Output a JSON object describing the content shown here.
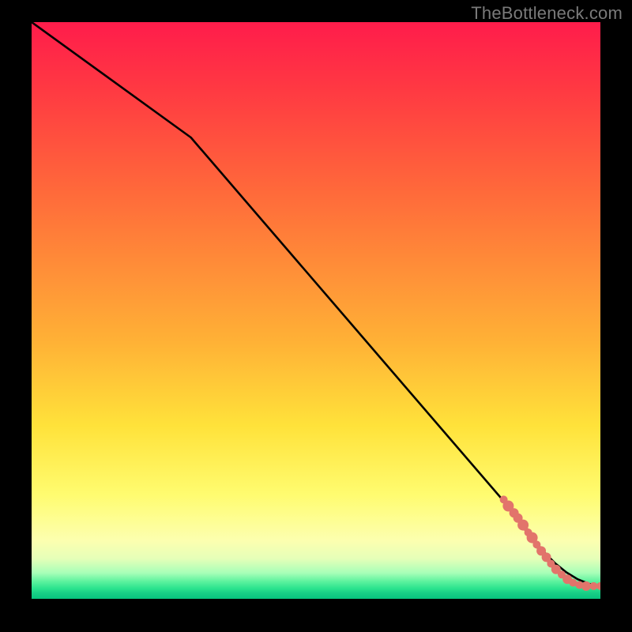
{
  "watermark": "TheBottleneck.com",
  "chart_data": {
    "type": "line",
    "title": "",
    "xlabel": "",
    "ylabel": "",
    "xlim": [
      0,
      100
    ],
    "ylim": [
      0,
      100
    ],
    "series": [
      {
        "name": "curve",
        "color": "#000000",
        "x": [
          0,
          28,
          86,
          88,
          90,
          92,
          94,
          96,
          98,
          100
        ],
        "y": [
          100,
          80,
          13.5,
          10.5,
          8.2,
          6.2,
          4.6,
          3.4,
          2.6,
          2.2
        ]
      }
    ],
    "scatter": {
      "name": "highlighted-segment",
      "color": "#e2746b",
      "points": [
        {
          "x": 83.0,
          "y": 17.2,
          "r": 3
        },
        {
          "x": 83.8,
          "y": 16.1,
          "r": 5
        },
        {
          "x": 84.8,
          "y": 14.9,
          "r": 4
        },
        {
          "x": 85.5,
          "y": 14.0,
          "r": 4
        },
        {
          "x": 86.4,
          "y": 12.8,
          "r": 5
        },
        {
          "x": 87.3,
          "y": 11.5,
          "r": 3
        },
        {
          "x": 88.0,
          "y": 10.6,
          "r": 5
        },
        {
          "x": 88.8,
          "y": 9.4,
          "r": 3
        },
        {
          "x": 89.6,
          "y": 8.3,
          "r": 4
        },
        {
          "x": 90.5,
          "y": 7.2,
          "r": 4
        },
        {
          "x": 91.3,
          "y": 6.1,
          "r": 3
        },
        {
          "x": 92.2,
          "y": 5.1,
          "r": 4
        },
        {
          "x": 93.2,
          "y": 4.2,
          "r": 3
        },
        {
          "x": 94.2,
          "y": 3.4,
          "r": 4
        },
        {
          "x": 95.2,
          "y": 2.8,
          "r": 3
        },
        {
          "x": 96.3,
          "y": 2.4,
          "r": 3
        },
        {
          "x": 97.5,
          "y": 2.2,
          "r": 4
        },
        {
          "x": 98.8,
          "y": 2.2,
          "r": 3
        },
        {
          "x": 100.0,
          "y": 2.2,
          "r": 3
        }
      ]
    }
  }
}
